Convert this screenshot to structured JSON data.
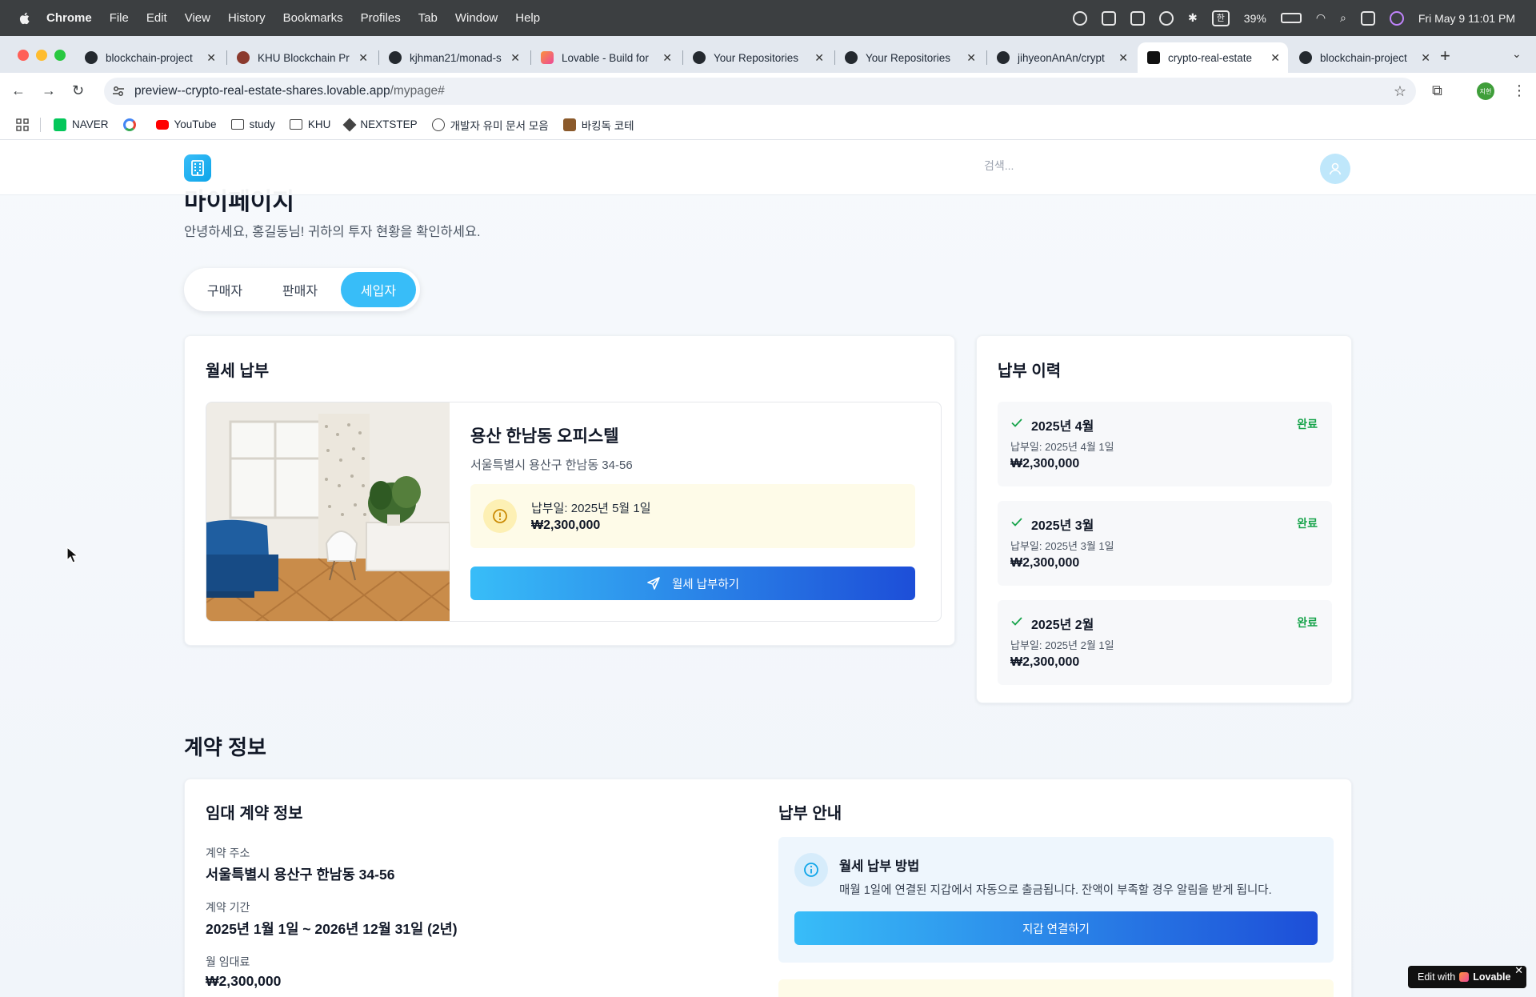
{
  "menubar": {
    "app": "Chrome",
    "items": [
      "File",
      "Edit",
      "View",
      "History",
      "Bookmarks",
      "Profiles",
      "Tab",
      "Window",
      "Help"
    ],
    "battery": "39%",
    "ime": "한",
    "datetime": "Fri May 9  11:01 PM"
  },
  "tabs": [
    {
      "title": "blockchain-project"
    },
    {
      "title": "KHU Blockchain Pr"
    },
    {
      "title": "kjhman21/monad-s"
    },
    {
      "title": "Lovable - Build for"
    },
    {
      "title": "Your Repositories"
    },
    {
      "title": "Your Repositories"
    },
    {
      "title": "jihyeonAnAn/crypt"
    },
    {
      "title": "crypto-real-estate"
    },
    {
      "title": "blockchain-project"
    }
  ],
  "address": {
    "host": "preview--crypto-real-estate-shares.lovable.app",
    "path": "/mypage#"
  },
  "profile_initials": "지현",
  "bookmarks": [
    "NAVER",
    "YouTube",
    "study",
    "KHU",
    "NEXTSTEP",
    "개발자 유미 문서 모음",
    "바킹독 코테"
  ],
  "nav": {
    "search_placeholder": "검색..."
  },
  "page": {
    "title": "마이페이지",
    "subtitle": "안녕하세요, 홍길동님! 귀하의 투자 현황을 확인하세요.",
    "roles": [
      "구매자",
      "판매자",
      "세입자"
    ],
    "active_role": "세입자"
  },
  "rent": {
    "title": "월세 납부",
    "property_name": "용산 한남동 오피스텔",
    "property_address": "서울특별시 용산구 한남동 34-56",
    "due_label": "납부일: 2025년 5월 1일",
    "due_amount": "₩2,300,000",
    "pay_button": "월세 납부하기"
  },
  "history": {
    "title": "납부 이력",
    "items": [
      {
        "month": "2025년 4월",
        "status": "완료",
        "date": "납부일: 2025년 4월 1일",
        "amount": "₩2,300,000"
      },
      {
        "month": "2025년 3월",
        "status": "완료",
        "date": "납부일: 2025년 3월 1일",
        "amount": "₩2,300,000"
      },
      {
        "month": "2025년 2월",
        "status": "완료",
        "date": "납부일: 2025년 2월 1일",
        "amount": "₩2,300,000"
      }
    ]
  },
  "contract": {
    "section_title": "계약 정보",
    "card_title": "임대 계약 정보",
    "address_label": "계약 주소",
    "address_value": "서울특별시 용산구 한남동 34-56",
    "period_label": "계약 기간",
    "period_value": "2025년 1월 1일 ~ 2026년 12월 31일 (2년)",
    "rent_label": "월 임대료",
    "rent_value": "₩2,300,000"
  },
  "guide": {
    "title": "납부 안내",
    "method_title": "월세 납부 방법",
    "method_desc": "매월 1일에 연결된 지갑에서 자동으로 출금됩니다. 잔액이 부족할 경우 알림을 받게 됩니다.",
    "wallet_button": "지갑 연결하기"
  },
  "badge": {
    "prefix": "Edit with",
    "brand": "Lovable"
  },
  "colors": {
    "accent": "#38bdf8",
    "gradient_end": "#1d4ed8",
    "success": "#16a34a",
    "warning_bg": "#fefbe8"
  }
}
